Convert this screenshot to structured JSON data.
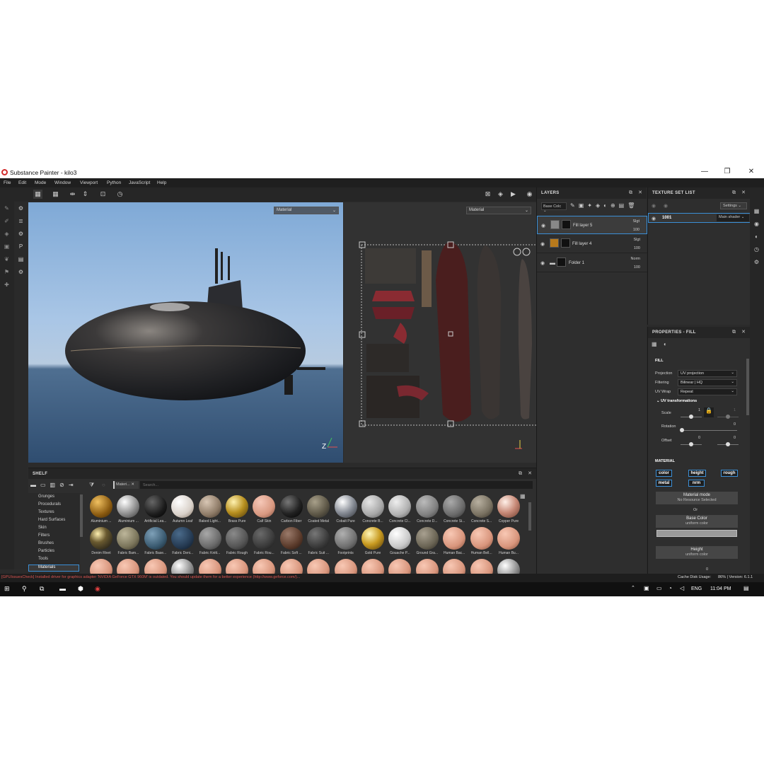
{
  "window": {
    "title": "Substance Painter - kilo3",
    "min": "—",
    "max": "❐",
    "close": "✕"
  },
  "menu": [
    "File",
    "Edit",
    "Mode",
    "Window",
    "Viewport",
    "Python",
    "JavaScript",
    "Help"
  ],
  "viewport3d": {
    "channel": "Material"
  },
  "viewport2d": {
    "channel": "Material"
  },
  "layers": {
    "title": "LAYERS",
    "channel": "Base Colc",
    "items": [
      {
        "name": "Fill layer 5",
        "blend": "Slgt",
        "opacity": "100",
        "selected": true
      },
      {
        "name": "Fill layer 4",
        "blend": "Slgt",
        "opacity": "100",
        "selected": false
      },
      {
        "name": "Folder 1",
        "blend": "Norm",
        "opacity": "100",
        "selected": false
      }
    ]
  },
  "texture_set_list": {
    "title": "TEXTURE SET LIST",
    "settings": "Settings",
    "set_name": "1001",
    "shader": "Main shader"
  },
  "properties": {
    "title": "PROPERTIES - FILL",
    "section": "FILL",
    "projection_label": "Projection",
    "projection_value": "UV projection",
    "filtering_label": "Filtering",
    "filtering_value": "Bilinear | HQ",
    "uvwrap_label": "UV Wrap",
    "uvwrap_value": "Repeat",
    "uvtrans": "UV transformations",
    "scale_label": "Scale",
    "scale_v1": "1",
    "scale_v2": "1",
    "rotation_label": "Rotation",
    "rotation_v": "0",
    "offset_label": "Offset",
    "offset_v1": "0",
    "offset_v2": "0",
    "material_section": "MATERIAL",
    "channels": [
      "color",
      "height",
      "rough",
      "metal",
      "nrm"
    ],
    "material_mode": "Material mode",
    "no_resource": "No Resource Selected",
    "or": "Or",
    "base_color": "Base Color",
    "uniform1": "uniform color",
    "height": "Height",
    "uniform2": "uniform color",
    "bottom_val": "0"
  },
  "shelf": {
    "title": "SHELF",
    "tab": "Materi...",
    "search_placeholder": "Search...",
    "categories": [
      "Grunges",
      "Procedurals",
      "Textures",
      "Hard Surfaces",
      "Skin",
      "Filters",
      "Brushes",
      "Particles",
      "Tools",
      "Materials"
    ],
    "row1": [
      "Aluminium ...",
      "Aluminium ...",
      "Artificial Lea...",
      "Autumn Leaf",
      "Baked Light...",
      "Brass Pure",
      "Calf Skin",
      "Carbon Fiber",
      "Coated Metal",
      "Cobalt Pure",
      "Concrete B...",
      "Concrete Cl...",
      "Concrete D...",
      "Concrete Si...",
      "Concrete S...",
      "Copper Pure"
    ],
    "row2": [
      "Denim Rivet",
      "Fabric Bam...",
      "Fabric Base...",
      "Fabric Deni...",
      "Fabric Knitt...",
      "Fabric Rough",
      "Fabric Rou...",
      "Fabric Soft ...",
      "Fabric Suit ...",
      "Footprints",
      "Gold Pure",
      "Gouache P...",
      "Ground Gra...",
      "Human Bac...",
      "Human Bell...",
      "Human Bu..."
    ]
  },
  "status": {
    "warning": "[GPUIssuesCheck] Installed driver for graphics adapter 'NVIDIA GeForce GTX 960M' is outdated. You should update them for a better experience (http://www.geforce.com/)...",
    "cache": "Cache Disk Usage:",
    "version": "86% | Version: 6.1.1"
  },
  "taskbar": {
    "lang": "ENG",
    "time": "11:04 PM"
  },
  "colors": {
    "accent": "#3b8fd6",
    "warn": "#d9534f"
  }
}
